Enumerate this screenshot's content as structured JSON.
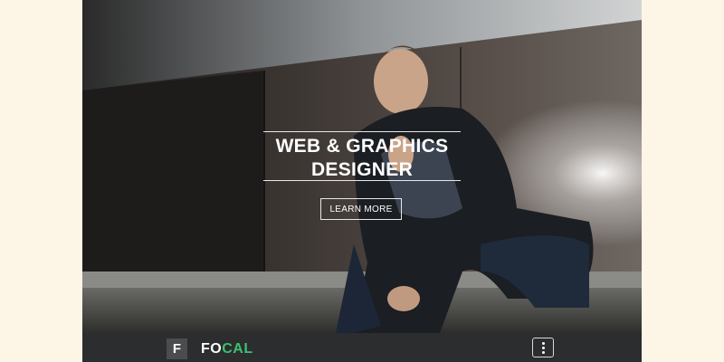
{
  "hero": {
    "headline_line1": "WEB & GRAPHICS",
    "headline_line2": "DESIGNER",
    "cta_label": "LEARN MORE"
  },
  "navbar": {
    "logo_letter": "F",
    "brand_part1": "FO",
    "brand_part2": "CAL",
    "menu_icon": "vertical-dots-icon"
  },
  "colors": {
    "page_background": "#fdf5e6",
    "navbar_background": "#2b2d2e",
    "brand_accent": "#3fbf6f"
  }
}
